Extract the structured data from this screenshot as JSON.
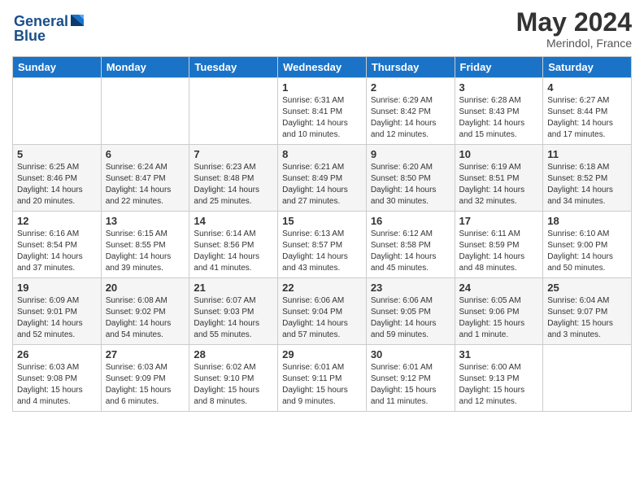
{
  "header": {
    "logo_line1": "General",
    "logo_line2": "Blue",
    "title": "May 2024",
    "location": "Merindol, France"
  },
  "days_of_week": [
    "Sunday",
    "Monday",
    "Tuesday",
    "Wednesday",
    "Thursday",
    "Friday",
    "Saturday"
  ],
  "weeks": [
    [
      {
        "day": "",
        "info": ""
      },
      {
        "day": "",
        "info": ""
      },
      {
        "day": "",
        "info": ""
      },
      {
        "day": "1",
        "info": "Sunrise: 6:31 AM\nSunset: 8:41 PM\nDaylight: 14 hours\nand 10 minutes."
      },
      {
        "day": "2",
        "info": "Sunrise: 6:29 AM\nSunset: 8:42 PM\nDaylight: 14 hours\nand 12 minutes."
      },
      {
        "day": "3",
        "info": "Sunrise: 6:28 AM\nSunset: 8:43 PM\nDaylight: 14 hours\nand 15 minutes."
      },
      {
        "day": "4",
        "info": "Sunrise: 6:27 AM\nSunset: 8:44 PM\nDaylight: 14 hours\nand 17 minutes."
      }
    ],
    [
      {
        "day": "5",
        "info": "Sunrise: 6:25 AM\nSunset: 8:46 PM\nDaylight: 14 hours\nand 20 minutes."
      },
      {
        "day": "6",
        "info": "Sunrise: 6:24 AM\nSunset: 8:47 PM\nDaylight: 14 hours\nand 22 minutes."
      },
      {
        "day": "7",
        "info": "Sunrise: 6:23 AM\nSunset: 8:48 PM\nDaylight: 14 hours\nand 25 minutes."
      },
      {
        "day": "8",
        "info": "Sunrise: 6:21 AM\nSunset: 8:49 PM\nDaylight: 14 hours\nand 27 minutes."
      },
      {
        "day": "9",
        "info": "Sunrise: 6:20 AM\nSunset: 8:50 PM\nDaylight: 14 hours\nand 30 minutes."
      },
      {
        "day": "10",
        "info": "Sunrise: 6:19 AM\nSunset: 8:51 PM\nDaylight: 14 hours\nand 32 minutes."
      },
      {
        "day": "11",
        "info": "Sunrise: 6:18 AM\nSunset: 8:52 PM\nDaylight: 14 hours\nand 34 minutes."
      }
    ],
    [
      {
        "day": "12",
        "info": "Sunrise: 6:16 AM\nSunset: 8:54 PM\nDaylight: 14 hours\nand 37 minutes."
      },
      {
        "day": "13",
        "info": "Sunrise: 6:15 AM\nSunset: 8:55 PM\nDaylight: 14 hours\nand 39 minutes."
      },
      {
        "day": "14",
        "info": "Sunrise: 6:14 AM\nSunset: 8:56 PM\nDaylight: 14 hours\nand 41 minutes."
      },
      {
        "day": "15",
        "info": "Sunrise: 6:13 AM\nSunset: 8:57 PM\nDaylight: 14 hours\nand 43 minutes."
      },
      {
        "day": "16",
        "info": "Sunrise: 6:12 AM\nSunset: 8:58 PM\nDaylight: 14 hours\nand 45 minutes."
      },
      {
        "day": "17",
        "info": "Sunrise: 6:11 AM\nSunset: 8:59 PM\nDaylight: 14 hours\nand 48 minutes."
      },
      {
        "day": "18",
        "info": "Sunrise: 6:10 AM\nSunset: 9:00 PM\nDaylight: 14 hours\nand 50 minutes."
      }
    ],
    [
      {
        "day": "19",
        "info": "Sunrise: 6:09 AM\nSunset: 9:01 PM\nDaylight: 14 hours\nand 52 minutes."
      },
      {
        "day": "20",
        "info": "Sunrise: 6:08 AM\nSunset: 9:02 PM\nDaylight: 14 hours\nand 54 minutes."
      },
      {
        "day": "21",
        "info": "Sunrise: 6:07 AM\nSunset: 9:03 PM\nDaylight: 14 hours\nand 55 minutes."
      },
      {
        "day": "22",
        "info": "Sunrise: 6:06 AM\nSunset: 9:04 PM\nDaylight: 14 hours\nand 57 minutes."
      },
      {
        "day": "23",
        "info": "Sunrise: 6:06 AM\nSunset: 9:05 PM\nDaylight: 14 hours\nand 59 minutes."
      },
      {
        "day": "24",
        "info": "Sunrise: 6:05 AM\nSunset: 9:06 PM\nDaylight: 15 hours\nand 1 minute."
      },
      {
        "day": "25",
        "info": "Sunrise: 6:04 AM\nSunset: 9:07 PM\nDaylight: 15 hours\nand 3 minutes."
      }
    ],
    [
      {
        "day": "26",
        "info": "Sunrise: 6:03 AM\nSunset: 9:08 PM\nDaylight: 15 hours\nand 4 minutes."
      },
      {
        "day": "27",
        "info": "Sunrise: 6:03 AM\nSunset: 9:09 PM\nDaylight: 15 hours\nand 6 minutes."
      },
      {
        "day": "28",
        "info": "Sunrise: 6:02 AM\nSunset: 9:10 PM\nDaylight: 15 hours\nand 8 minutes."
      },
      {
        "day": "29",
        "info": "Sunrise: 6:01 AM\nSunset: 9:11 PM\nDaylight: 15 hours\nand 9 minutes."
      },
      {
        "day": "30",
        "info": "Sunrise: 6:01 AM\nSunset: 9:12 PM\nDaylight: 15 hours\nand 11 minutes."
      },
      {
        "day": "31",
        "info": "Sunrise: 6:00 AM\nSunset: 9:13 PM\nDaylight: 15 hours\nand 12 minutes."
      },
      {
        "day": "",
        "info": ""
      }
    ]
  ]
}
